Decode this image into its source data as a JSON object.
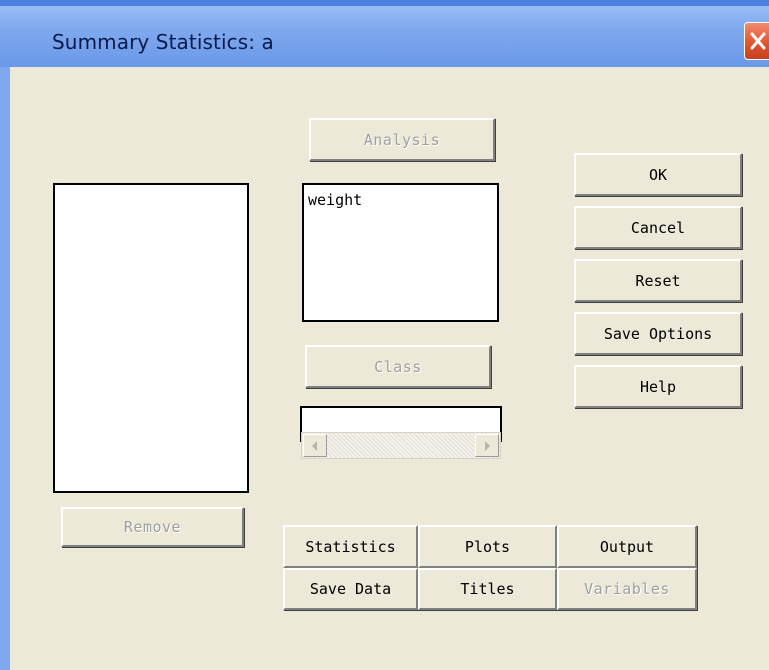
{
  "window": {
    "title": "Summary Statistics: a"
  },
  "buttons": {
    "analysis": "Analysis",
    "class": "Class",
    "remove": "Remove",
    "ok": "OK",
    "cancel": "Cancel",
    "reset": "Reset",
    "save_options": "Save Options",
    "help": "Help"
  },
  "analysis_list": {
    "items": [
      "weight"
    ]
  },
  "tabs": {
    "statistics": "Statistics",
    "plots": "Plots",
    "output": "Output",
    "save_data": "Save Data",
    "titles": "Titles",
    "variables": "Variables"
  },
  "icons": {
    "close": "close-icon",
    "scroll_left": "scroll-left-arrow-icon",
    "scroll_right": "scroll-right-arrow-icon"
  }
}
